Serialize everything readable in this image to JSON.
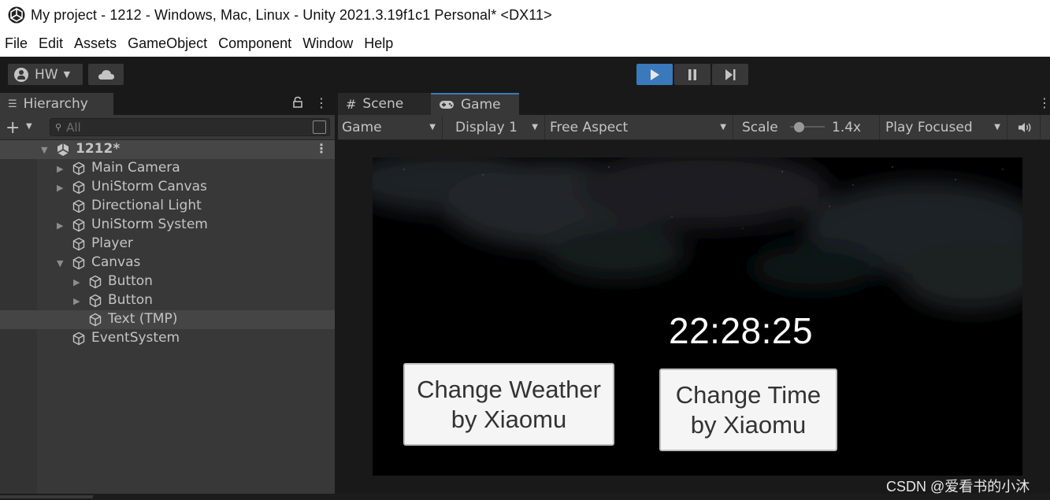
{
  "window": {
    "title": "My project - 1212 - Windows, Mac, Linux - Unity 2021.3.19f1c1 Personal* <DX11>"
  },
  "menu": [
    "File",
    "Edit",
    "Assets",
    "GameObject",
    "Component",
    "Window",
    "Help"
  ],
  "toolbar": {
    "account_label": "HW",
    "accent_color": "#3a79bb"
  },
  "hierarchy": {
    "tab_label": "Hierarchy",
    "search_placeholder": "All",
    "scene_name": "1212*",
    "items": [
      {
        "label": "Main Camera",
        "depth": 1,
        "expandable": true,
        "expanded": false
      },
      {
        "label": "UniStorm Canvas",
        "depth": 1,
        "expandable": true,
        "expanded": false
      },
      {
        "label": "Directional Light",
        "depth": 1,
        "expandable": false,
        "expanded": false
      },
      {
        "label": "UniStorm System",
        "depth": 1,
        "expandable": true,
        "expanded": false
      },
      {
        "label": "Player",
        "depth": 1,
        "expandable": false,
        "expanded": false
      },
      {
        "label": "Canvas",
        "depth": 1,
        "expandable": true,
        "expanded": true
      },
      {
        "label": "Button",
        "depth": 2,
        "expandable": true,
        "expanded": false
      },
      {
        "label": "Button",
        "depth": 2,
        "expandable": true,
        "expanded": false
      },
      {
        "label": "Text (TMP)",
        "depth": 2,
        "expandable": false,
        "expanded": false,
        "selected": true
      },
      {
        "label": "EventSystem",
        "depth": 1,
        "expandable": false,
        "expanded": false
      }
    ]
  },
  "view_tabs": {
    "scene_label": "Scene",
    "game_label": "Game"
  },
  "game_toolbar": {
    "mode": "Game",
    "display": "Display 1",
    "aspect": "Free Aspect",
    "scale_label": "Scale",
    "scale_value": "1.4x",
    "play_mode": "Play Focused"
  },
  "game_view": {
    "clock": "22:28:25",
    "button1": {
      "line1": "Change Weather",
      "line2": "by Xiaomu"
    },
    "button2": {
      "line1": "Change Time",
      "line2": "by Xiaomu"
    }
  },
  "watermark": "CSDN @爱看书的小沐"
}
